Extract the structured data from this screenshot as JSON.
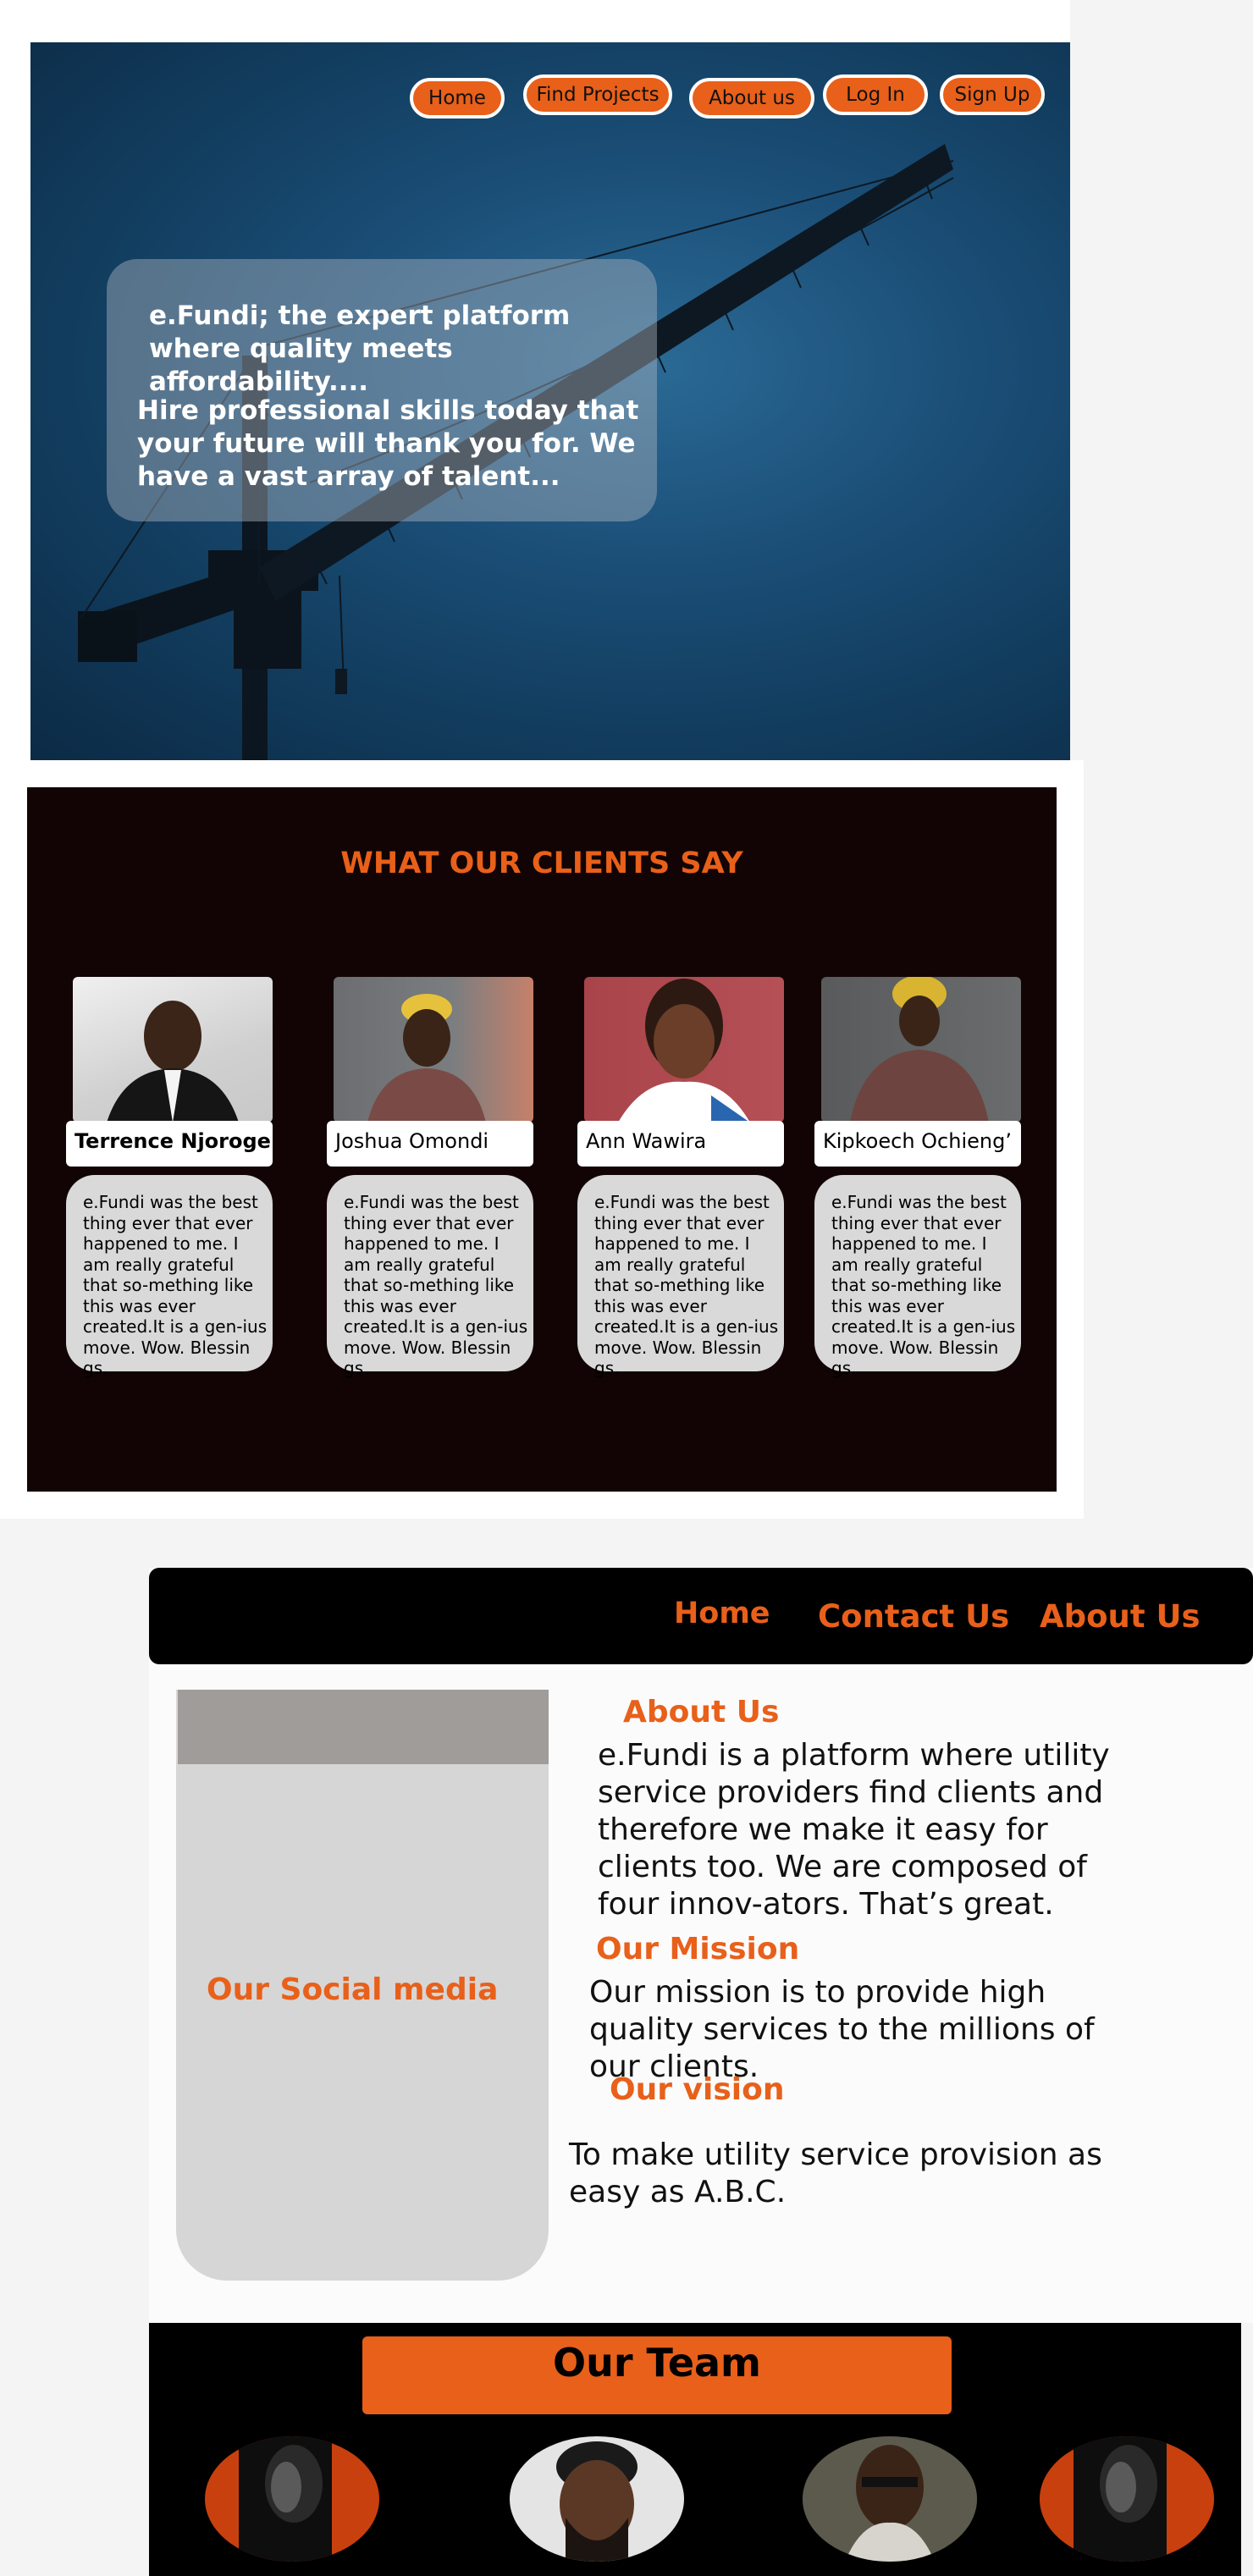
{
  "hero": {
    "nav": [
      "Home",
      "Find Projects",
      "About us",
      "Log In",
      "Sign Up"
    ],
    "headline": "e.Fundi; the expert platform where quality meets affordability....",
    "subline": "Hire professional skills today that your future will thank you for. We have a vast array of talent..."
  },
  "testimonials": {
    "title": "WHAT OUR CLIENTS SAY",
    "items": [
      {
        "name": "Terrence Njoroge",
        "quote": "e.Fundi was the best thing ever that ever happened to me. I am really grateful that so-mething like this was ever created.It is a gen-ius move. Wow. Blessin gs."
      },
      {
        "name": "Joshua Omondi",
        "quote": "e.Fundi was the best thing ever that ever happened to me. I am really grateful that so-mething like this was ever created.It is a gen-ius move. Wow. Blessin gs."
      },
      {
        "name": "Ann Wawira",
        "quote": "e.Fundi was the best thing ever that ever happened to me. I am really grateful that so-mething like this was ever created.It is a gen-ius move. Wow. Blessin gs."
      },
      {
        "name": "Kipkoech Ochieng’",
        "quote": "e.Fundi was the best thing ever that ever happened to me. I am really grateful that so-mething like this was ever created.It is a gen-ius move. Wow. Blessin gs."
      }
    ]
  },
  "about": {
    "nav": [
      "Home",
      "Contact Us",
      "About Us"
    ],
    "social_label": "Our Social media",
    "about_heading": "About Us",
    "about_text": "e.Fundi is a platform where utility service providers find clients and therefore we make it easy for clients too. We are composed of four innov-ators. That’s great.",
    "mission_heading": "Our Mission",
    "mission_text": "Our mission is to provide high quality services to the millions of our clients.",
    "vision_heading": "Our vision",
    "vision_text": "To make utility service provision as easy as A.B.C."
  },
  "team": {
    "title": "Our Team"
  },
  "colors": {
    "accent": "#e8601a",
    "hero_blue": "#1b4f78",
    "testimonial_bg": "#120404",
    "quote_bg": "#d9d9d9"
  }
}
